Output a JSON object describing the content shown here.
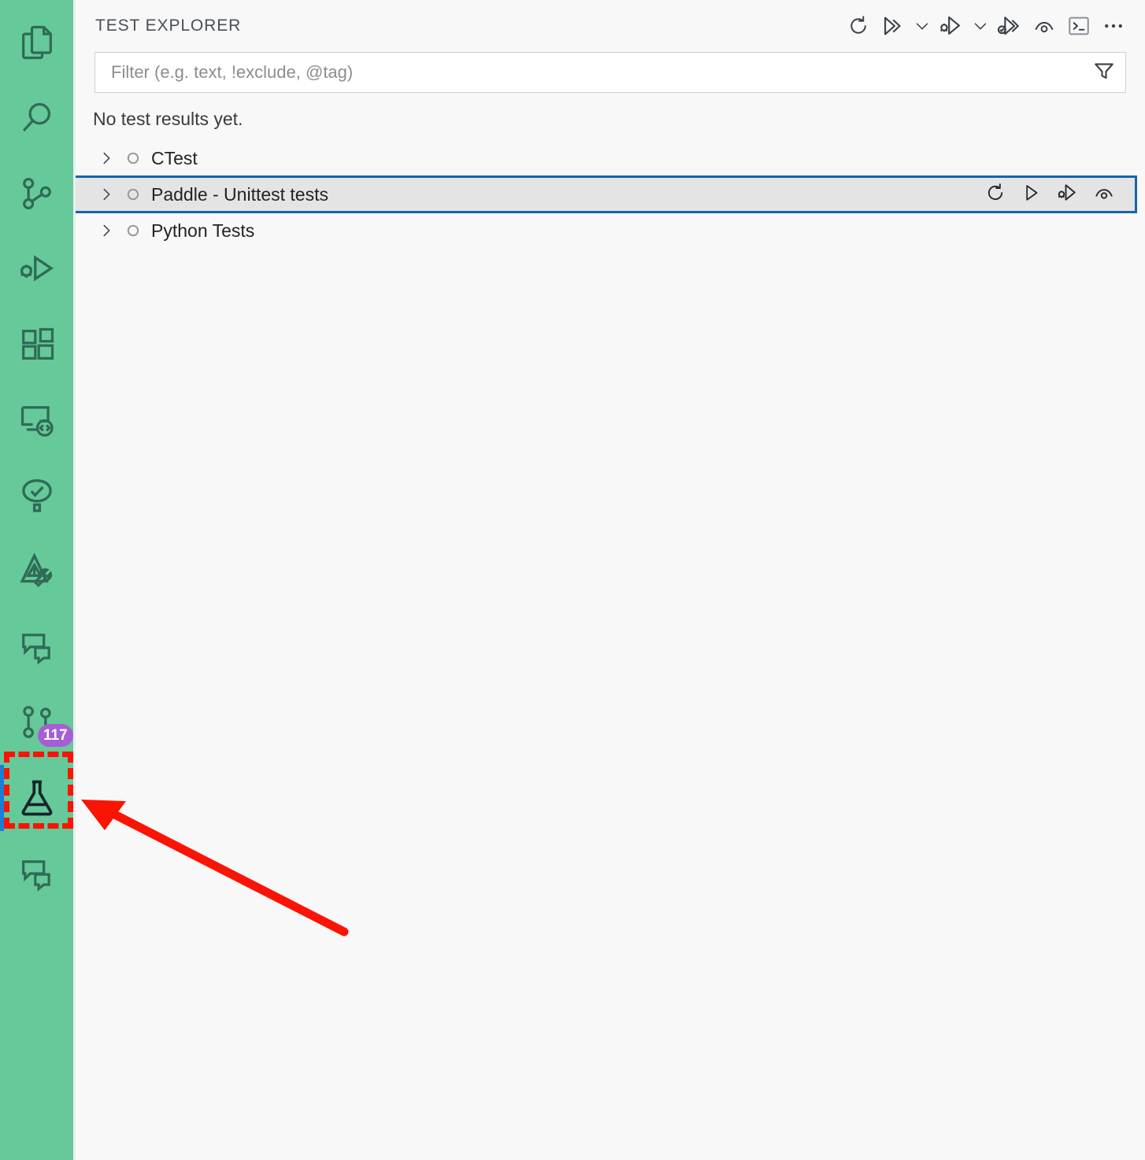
{
  "theme": {
    "activity_bar_bg": "#66c99a",
    "activity_icon_color": "#2f6b56",
    "panel_bg": "#f8f8f8",
    "accent_blue": "#1464ae",
    "active_indicator": "#1a7fd4",
    "badge_bg": "#a55ed6",
    "annotation_red": "#fa1405",
    "selected_row_bg": "#e4e4e4"
  },
  "activity_bar": {
    "items": [
      {
        "name": "explorer",
        "icon": "files-icon",
        "label": "Explorer",
        "badge": null,
        "active": false
      },
      {
        "name": "search",
        "icon": "search-icon",
        "label": "Search",
        "badge": null,
        "active": false
      },
      {
        "name": "source-control",
        "icon": "source-control-icon",
        "label": "Source Control",
        "badge": null,
        "active": false
      },
      {
        "name": "run-and-debug",
        "icon": "run-and-debug-icon",
        "label": "Run and Debug",
        "badge": null,
        "active": false
      },
      {
        "name": "extensions",
        "icon": "extensions-icon",
        "label": "Extensions",
        "badge": null,
        "active": false
      },
      {
        "name": "remote-explorer",
        "icon": "remote-explorer-icon",
        "label": "Remote Explorer",
        "badge": null,
        "active": false
      },
      {
        "name": "github-actions",
        "icon": "github-actions-icon",
        "label": "GitHub Actions",
        "badge": null,
        "active": false
      },
      {
        "name": "azure-tools",
        "icon": "azure-tools-icon",
        "label": "Azure",
        "badge": null,
        "active": false
      },
      {
        "name": "comments",
        "icon": "comment-icon",
        "label": "Comments",
        "badge": null,
        "active": false
      },
      {
        "name": "pull-requests",
        "icon": "git-pull-request-icon",
        "label": "Pull Requests",
        "badge": "117",
        "active": false
      },
      {
        "name": "testing",
        "icon": "beaker-icon",
        "label": "Testing",
        "badge": null,
        "active": true
      },
      {
        "name": "chat",
        "icon": "comment-icon",
        "label": "Chat",
        "badge": null,
        "active": false
      }
    ]
  },
  "panel": {
    "title": "TEST EXPLORER",
    "actions": [
      {
        "name": "refresh-tests-button",
        "icon": "refresh-icon",
        "label": "Refresh Tests"
      },
      {
        "name": "run-all-tests-button",
        "icon": "run-all-icon",
        "label": "Run All Tests"
      },
      {
        "name": "run-all-dropdown-button",
        "icon": "chevron-down-icon",
        "label": "Run Profiles"
      },
      {
        "name": "debug-all-tests-button",
        "icon": "debug-all-icon",
        "label": "Debug All Tests"
      },
      {
        "name": "debug-all-dropdown-button",
        "icon": "chevron-down-icon",
        "label": "Debug Profiles"
      },
      {
        "name": "run-tests-with-coverage-button",
        "icon": "coverage-icon",
        "label": "Run Tests with Coverage"
      },
      {
        "name": "continuous-run-button",
        "icon": "eye-icon",
        "label": "Toggle Continuous Run"
      },
      {
        "name": "show-output-button",
        "icon": "terminal-icon",
        "label": "Show Output"
      },
      {
        "name": "more-actions-button",
        "icon": "ellipsis-icon",
        "label": "Views and More Actions..."
      }
    ]
  },
  "filter": {
    "value": "",
    "placeholder": "Filter (e.g. text, !exclude, @tag)",
    "icon": "funnel-icon",
    "icon_label": "Filter Options"
  },
  "status": {
    "message": "No test results yet."
  },
  "tree": {
    "rows": [
      {
        "name": "ctest",
        "label": "CTest",
        "twisty": "chevron-right-icon",
        "state": "unset-circle-icon",
        "expanded": false,
        "selected": false
      },
      {
        "name": "paddle-unittest-tests",
        "label": "Paddle - Unittest tests",
        "twisty": "chevron-right-icon",
        "state": "unset-circle-icon",
        "expanded": false,
        "selected": true,
        "actions": [
          {
            "name": "refresh-tests-button",
            "icon": "refresh-icon",
            "label": "Refresh Tests"
          },
          {
            "name": "run-test-button",
            "icon": "run-icon",
            "label": "Run Test"
          },
          {
            "name": "debug-test-button",
            "icon": "debug-icon",
            "label": "Debug Test"
          },
          {
            "name": "continuous-run-button",
            "icon": "eye-icon",
            "label": "Toggle Continuous Run"
          }
        ]
      },
      {
        "name": "python-tests",
        "label": "Python Tests",
        "twisty": "chevron-right-icon",
        "state": "unset-circle-icon",
        "expanded": false,
        "selected": false
      }
    ]
  },
  "annotation": {
    "highlight_target": "testing",
    "arrow": "pointer-arrow",
    "color": "#fa1405"
  }
}
